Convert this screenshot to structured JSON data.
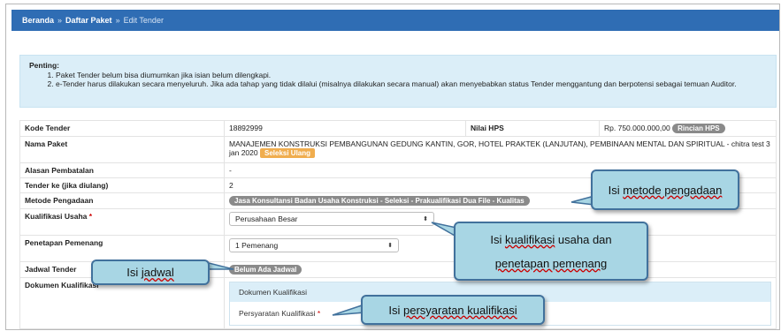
{
  "breadcrumb": {
    "home": "Beranda",
    "sep": "»",
    "list": "Daftar Paket",
    "current": "Edit Tender"
  },
  "alert": {
    "title": "Penting:",
    "items": [
      "Paket Tender belum bisa diumumkan jika isian belum dilengkapi.",
      "e-Tender harus dilakukan secara menyeluruh. Jika ada tahap yang tidak dilalui (misalnya dilakukan secara manual) akan menyebabkan status Tender menggantung dan berpotensi sebagai temuan Auditor."
    ]
  },
  "form": {
    "kode_label": "Kode Tender",
    "kode_value": "18892999",
    "hps_label": "Nilai HPS",
    "hps_value": "Rp. 750.000.000,00",
    "hps_button": "Rincian HPS",
    "nama_label": "Nama Paket",
    "nama_value": "MANAJEMEN KONSTRUKSI PEMBANGUNAN GEDUNG KANTIN, GOR, HOTEL PRAKTEK (LANJUTAN), PEMBINAAN MENTAL DAN SPIRITUAL - chitra test 3 jan 2020",
    "nama_badge": "Seleksi Ulang",
    "alasan_label": "Alasan Pembatalan",
    "alasan_value": "-",
    "tender_ke_label": "Tender ke (jika diulang)",
    "tender_ke_value": "2",
    "metode_label": "Metode Pengadaan",
    "metode_value": "Jasa Konsultansi Badan Usaha Konstruksi - Seleksi - Prakualifikasi Dua File - Kualitas",
    "kualifikasi_label": "Kualifikasi Usaha",
    "kualifikasi_req": "*",
    "kualifikasi_value": "Perusahaan Besar",
    "penetapan_label": "Penetapan Pemenang",
    "penetapan_value": "1 Pemenang",
    "jadwal_label": "Jadwal Tender",
    "jadwal_value": "Belum Ada Jadwal",
    "dokumen_label": "Dokumen Kualifikasi",
    "dokumen_panel_title": "Dokumen Kualifikasi",
    "persyaratan_label": "Persyaratan Kualifikasi",
    "persyaratan_req": "*"
  },
  "callouts": {
    "metode": {
      "prefix": "Isi ",
      "underlined": "metode pengadaan"
    },
    "kualifikasi": {
      "prefix": "Isi ",
      "underlined": "kualifikasi",
      "middle": " usaha dan",
      "line2_underlined": "penetapan pemenang"
    },
    "jadwal": {
      "prefix": "Isi ",
      "underlined": "jadwal"
    },
    "persyaratan": {
      "prefix": "Isi ",
      "underlined": "persyaratan kualifikasi"
    }
  },
  "colors": {
    "header_bg": "#2f6db4",
    "alert_bg": "#dbeef8",
    "callout_bg": "#a8d6e4",
    "callout_border": "#41719c",
    "badge_orange": "#f0ad4e",
    "badge_gray": "#8a8a8a"
  }
}
